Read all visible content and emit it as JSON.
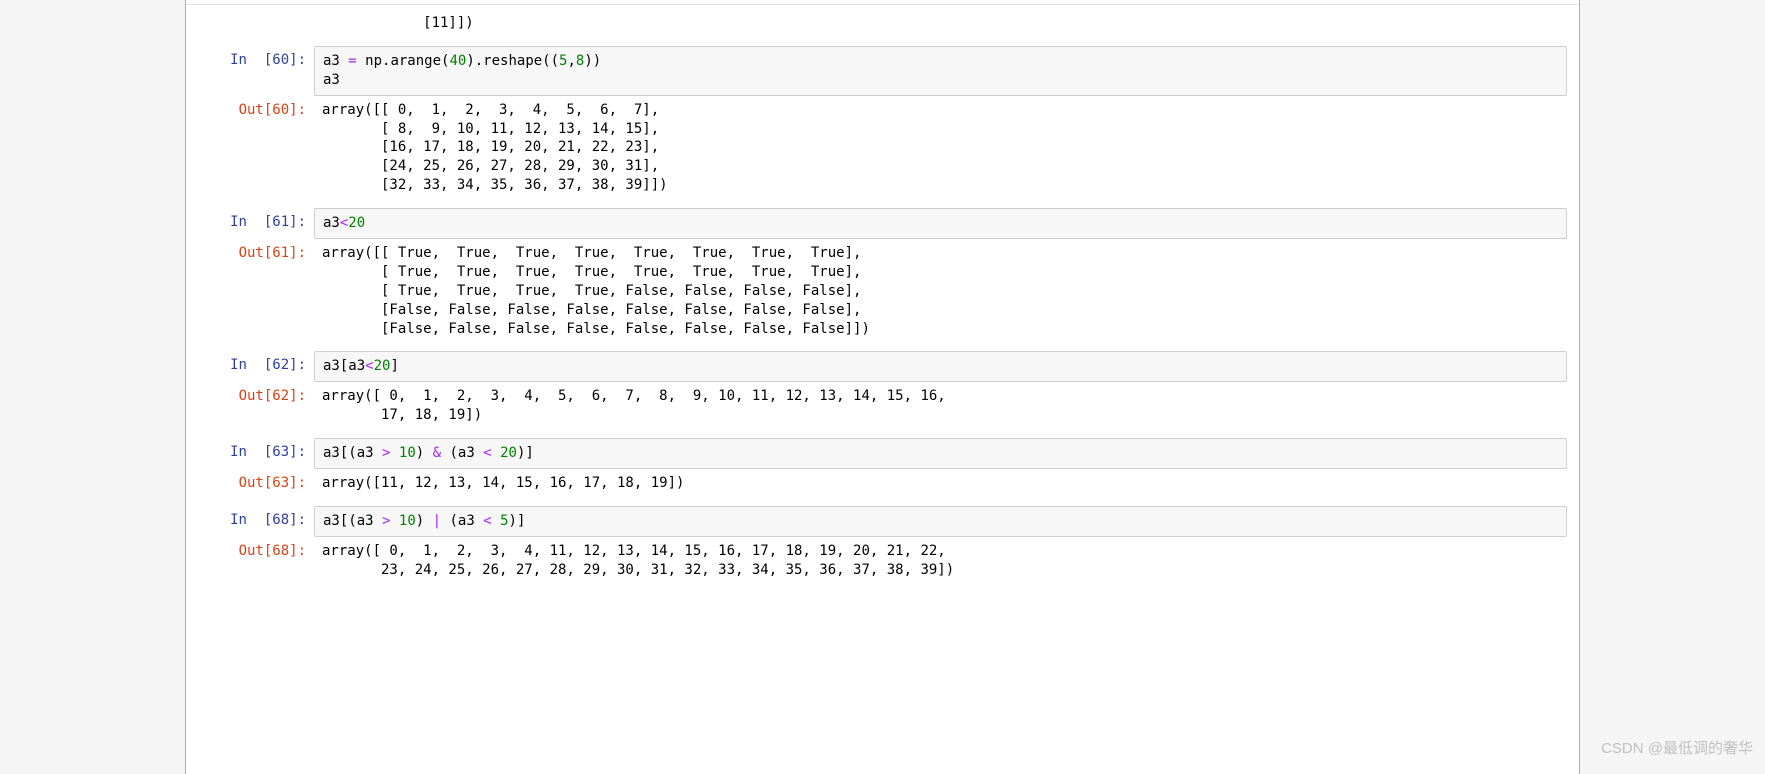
{
  "watermark": "CSDN @最低调的奢华",
  "cells": [
    {
      "type": "out_fragment",
      "out_lines": "            [11]])"
    },
    {
      "type": "code",
      "in_num": "60",
      "code_html": "a3 <span class='op'>=</span> np.arange(<span class='num'>40</span>).reshape((<span class='num'>5</span>,<span class='num'>8</span>))\na3",
      "out_num": "60",
      "out": "array([[ 0,  1,  2,  3,  4,  5,  6,  7],\n       [ 8,  9, 10, 11, 12, 13, 14, 15],\n       [16, 17, 18, 19, 20, 21, 22, 23],\n       [24, 25, 26, 27, 28, 29, 30, 31],\n       [32, 33, 34, 35, 36, 37, 38, 39]])"
    },
    {
      "type": "code",
      "in_num": "61",
      "code_html": "a3<span class='op'>&lt;</span><span class='num'>20</span>",
      "out_num": "61",
      "out": "array([[ True,  True,  True,  True,  True,  True,  True,  True],\n       [ True,  True,  True,  True,  True,  True,  True,  True],\n       [ True,  True,  True,  True, False, False, False, False],\n       [False, False, False, False, False, False, False, False],\n       [False, False, False, False, False, False, False, False]])"
    },
    {
      "type": "code",
      "in_num": "62",
      "code_html": "a3[a3<span class='op'>&lt;</span><span class='num'>20</span>]",
      "out_num": "62",
      "out": "array([ 0,  1,  2,  3,  4,  5,  6,  7,  8,  9, 10, 11, 12, 13, 14, 15, 16,\n       17, 18, 19])"
    },
    {
      "type": "code",
      "in_num": "63",
      "code_html": "a3[(a3 <span class='op'>&gt;</span> <span class='num'>10</span>) <span class='op'>&amp;</span> (a3 <span class='op'>&lt;</span> <span class='num'>20</span>)]",
      "out_num": "63",
      "out": "array([11, 12, 13, 14, 15, 16, 17, 18, 19])"
    },
    {
      "type": "code",
      "in_num": "68",
      "code_html": "a3[(a3 <span class='op'>&gt;</span> <span class='num'>10</span>) <span class='op'>|</span> (a3 <span class='op'>&lt;</span> <span class='num'>5</span>)]",
      "out_num": "68",
      "out": "array([ 0,  1,  2,  3,  4, 11, 12, 13, 14, 15, 16, 17, 18, 19, 20, 21, 22,\n       23, 24, 25, 26, 27, 28, 29, 30, 31, 32, 33, 34, 35, 36, 37, 38, 39])"
    }
  ],
  "labels": {
    "in_prefix": "In  [",
    "out_prefix": "Out[",
    "suffix": "]:"
  }
}
